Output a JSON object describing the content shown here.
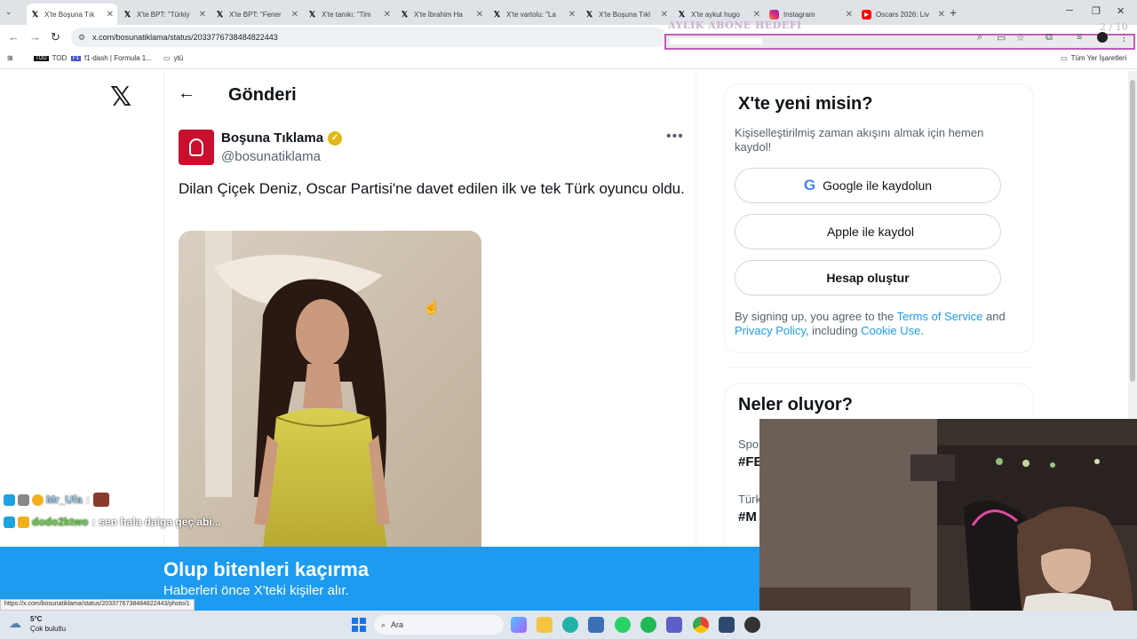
{
  "browser": {
    "tabs": [
      {
        "title": "X'te Boşuna Tık",
        "icon": "x-icon"
      },
      {
        "title": "X'te BPT: \"Türkiy",
        "icon": "x-icon"
      },
      {
        "title": "X'te BPT: \"Fener",
        "icon": "x-icon"
      },
      {
        "title": "X'te tanıkı: \"Tim",
        "icon": "x-icon"
      },
      {
        "title": "X'te İbrahim Ha",
        "icon": "x-icon"
      },
      {
        "title": "X'te vartolu: \"La",
        "icon": "x-icon"
      },
      {
        "title": "X'te Boşuna Tıkl",
        "icon": "x-icon"
      },
      {
        "title": "X'te aykut hugo",
        "icon": "x-icon"
      },
      {
        "title": "Instagram",
        "icon": "instagram-icon"
      },
      {
        "title": "Oscars 2026: Liv",
        "icon": "youtube-icon"
      }
    ],
    "url": "x.com/bosunatiklama/status/2033776738484822443",
    "bookmarks": [
      {
        "label": "TOD"
      },
      {
        "label": "f1-dash | Formula 1..."
      },
      {
        "label": "ytü"
      }
    ],
    "all_bookmarks_label": "Tüm Yer İşaretleri",
    "status_url": "https://x.com/bosunatiklama/status/2033776738484822443/photo/1"
  },
  "stream_overlay": {
    "goal_title": "AYLIK ABONE HEDEFİ",
    "goal_count": "2 / 10",
    "goal_progress": 0.2,
    "chat": [
      {
        "user": "Mr_Ufa",
        "sep": ":",
        "message": ""
      },
      {
        "user": "dodo2ktwo",
        "sep": ":",
        "message": "sen hala dalga geç abi..."
      }
    ]
  },
  "post": {
    "header_title": "Gönderi",
    "author_name": "Boşuna Tıklama",
    "author_handle": "@bosunatiklama",
    "text": "Dilan Çiçek Deniz, Oscar Partisi'ne davet edilen ilk ve tek Türk oyuncu oldu."
  },
  "signup": {
    "title": "X'te yeni misin?",
    "description": "Kişiselleştirilmiş zaman akışını almak için hemen kaydol!",
    "google_button": "Google ile kaydolun",
    "apple_button": "Apple ile kaydol",
    "create_button": "Hesap oluştur",
    "legal_prefix": "By signing up, you agree to the ",
    "terms_link": "Terms of Service",
    "legal_and": " and ",
    "privacy_link": "Privacy Policy",
    "legal_including": ", including ",
    "cookie_link": "Cookie Use",
    "legal_end": "."
  },
  "trends": {
    "title": "Neler oluyor?",
    "items": [
      {
        "category": "Spo",
        "tag": "#FE"
      },
      {
        "category": "Türk",
        "tag": "#M"
      }
    ]
  },
  "banner": {
    "title": "Olup bitenleri kaçırma",
    "subtitle": "Haberleri önce X'teki kişiler alır."
  },
  "taskbar": {
    "temperature": "5°C",
    "weather": "Çok bulutlu",
    "search_placeholder": "Ara"
  }
}
